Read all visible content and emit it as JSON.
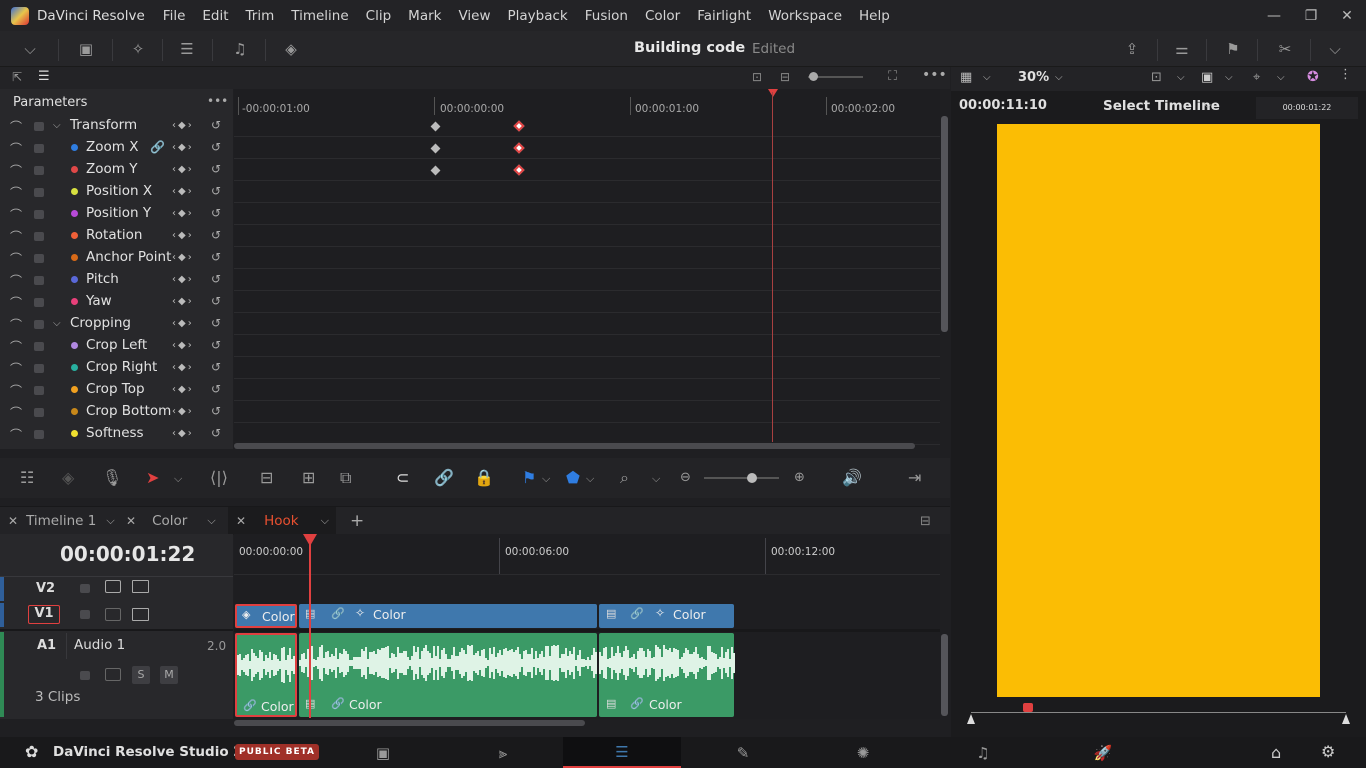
{
  "app": {
    "name": "DaVinci Resolve",
    "menu": [
      "File",
      "Edit",
      "Trim",
      "Timeline",
      "Clip",
      "Mark",
      "View",
      "Playback",
      "Fusion",
      "Color",
      "Fairlight",
      "Workspace",
      "Help"
    ]
  },
  "project": {
    "title": "Building code",
    "state": "Edited"
  },
  "keyframes": {
    "panel_title": "Parameters",
    "ruler": [
      "-00:00:01:00",
      "00:00:00:00",
      "00:00:01:00",
      "00:00:02:00"
    ],
    "params": [
      {
        "name": "Transform",
        "group": true,
        "color": ""
      },
      {
        "name": "Zoom X",
        "group": false,
        "color": "#2f7de1"
      },
      {
        "name": "Zoom Y",
        "group": false,
        "color": "#e04848"
      },
      {
        "name": "Position X",
        "group": false,
        "color": "#d7e040"
      },
      {
        "name": "Position Y",
        "group": false,
        "color": "#b84ad8"
      },
      {
        "name": "Rotation",
        "group": false,
        "color": "#f06038"
      },
      {
        "name": "Anchor Point",
        "group": false,
        "color": "#d86a18"
      },
      {
        "name": "Pitch",
        "group": false,
        "color": "#5a68d8"
      },
      {
        "name": "Yaw",
        "group": false,
        "color": "#e8407a"
      },
      {
        "name": "Cropping",
        "group": true,
        "color": ""
      },
      {
        "name": "Crop Left",
        "group": false,
        "color": "#b088e0"
      },
      {
        "name": "Crop Right",
        "group": false,
        "color": "#28b0a0"
      },
      {
        "name": "Crop Top",
        "group": false,
        "color": "#f0a020"
      },
      {
        "name": "Crop Bottom",
        "group": false,
        "color": "#c8881a"
      },
      {
        "name": "Softness",
        "group": false,
        "color": "#f0e030"
      }
    ]
  },
  "tabs": [
    {
      "label": "Timeline 1",
      "active": false
    },
    {
      "label": "Color",
      "active": false
    },
    {
      "label": "Hook",
      "active": true
    }
  ],
  "timeline": {
    "timecode": "00:00:01:22",
    "ruler": [
      "00:00:00:00",
      "00:00:06:00",
      "00:00:12:00"
    ],
    "tracks": {
      "v2": "V2",
      "v1": "V1",
      "a1": "A1",
      "a1_name": "Audio 1",
      "a1_channels": "2.0",
      "a1_clips": "3 Clips",
      "solo": "S",
      "mute": "M"
    },
    "clip_label": "Color"
  },
  "viewer": {
    "zoom": "30%",
    "timecode": "00:00:11:10",
    "select": "Select Timeline",
    "small_tc": "00:00:01:22",
    "frame_color": "#fbbd04"
  },
  "footer": {
    "product": "DaVinci Resolve Studio 20",
    "badge": "PUBLIC BETA"
  }
}
